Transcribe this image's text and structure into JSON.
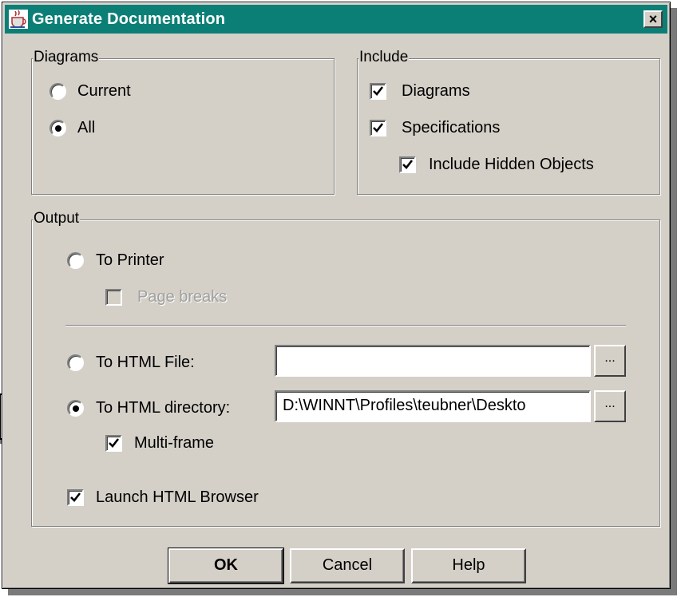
{
  "window": {
    "title": "Generate Documentation",
    "close_label": "×"
  },
  "diagrams_group": {
    "legend": "Diagrams",
    "options": [
      {
        "label": "Current",
        "selected": false
      },
      {
        "label": "All",
        "selected": true
      }
    ]
  },
  "include_group": {
    "legend": "Include",
    "items": [
      {
        "label": "Diagrams",
        "checked": true
      },
      {
        "label": "Specifications",
        "checked": true
      },
      {
        "label": "Include Hidden Objects",
        "checked": true
      }
    ]
  },
  "output_group": {
    "legend": "Output",
    "to_printer": {
      "label": "To Printer",
      "selected": false
    },
    "page_breaks": {
      "label": "Page breaks",
      "checked": false,
      "disabled": true
    },
    "to_html_file": {
      "label": "To HTML File:",
      "selected": false,
      "value": "",
      "browse_label": "..."
    },
    "to_html_directory": {
      "label": "To HTML directory:",
      "selected": true,
      "value": "D:\\WINNT\\Profiles\\teubner\\Deskto",
      "browse_label": "..."
    },
    "multi_frame": {
      "label": "Multi-frame",
      "checked": true
    },
    "launch_browser": {
      "label": "Launch HTML Browser",
      "checked": true
    }
  },
  "buttons": {
    "ok": "OK",
    "cancel": "Cancel",
    "help": "Help"
  },
  "colors": {
    "titlebar": "#0b7f76",
    "face": "#d4d0c8"
  }
}
